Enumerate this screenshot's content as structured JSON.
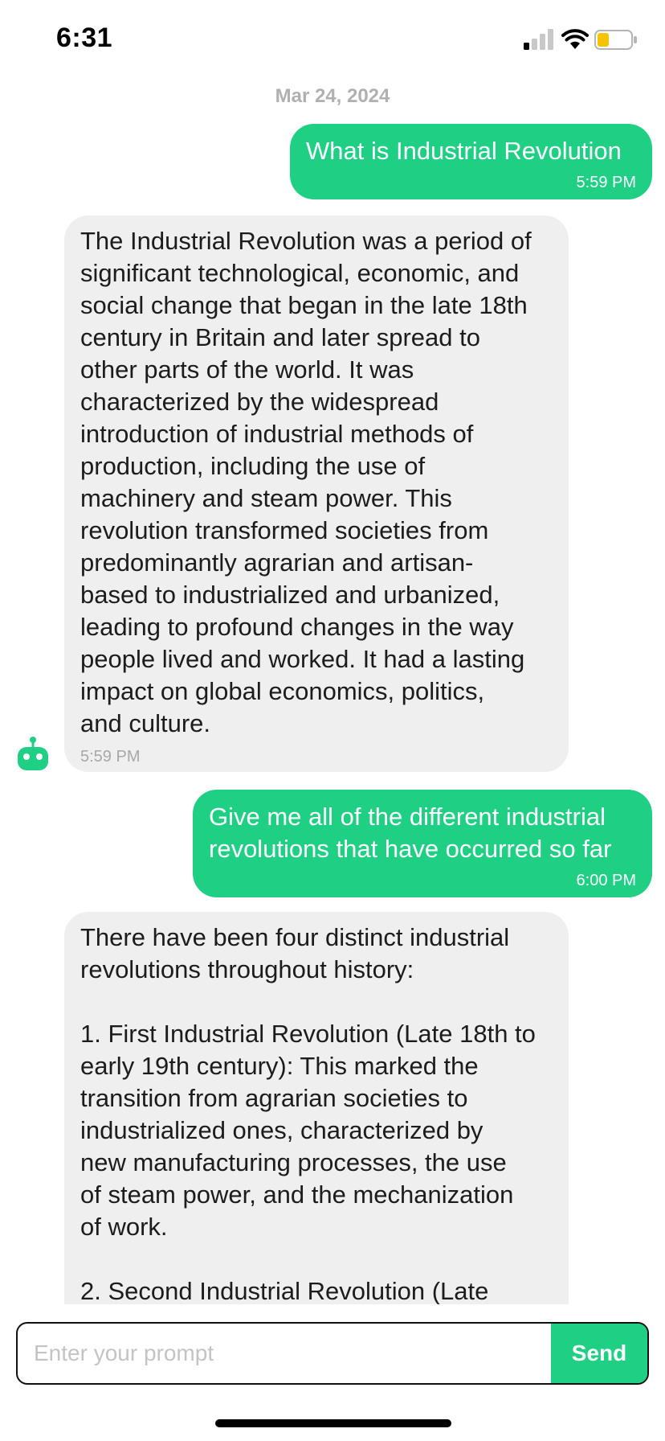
{
  "status_bar": {
    "time": "6:31",
    "signal": "signal-bars-icon",
    "wifi": "wifi-icon",
    "battery": "battery-low-icon",
    "battery_color": "#f5c400"
  },
  "chat": {
    "date": "Mar 24, 2024",
    "messages": [
      {
        "role": "user",
        "text": "What is Industrial Revolution",
        "time": "5:59 PM"
      },
      {
        "role": "bot",
        "text": "The Industrial Revolution was a period of\nsignificant technological, economic, and\nsocial change that began in the late 18th\ncentury in Britain and later spread to\nother parts of the world. It was\ncharacterized by the widespread\nintroduction of industrial methods of\nproduction, including the use of\nmachinery and steam power. This\nrevolution transformed societies from\npredominantly agrarian and artisan-\nbased to industrialized and urbanized,\nleading to profound changes in the way\npeople lived and worked. It had a lasting\nimpact on global economics, politics,\nand culture.",
        "time": "5:59 PM"
      },
      {
        "role": "user",
        "text": "Give me all of the different industrial\nrevolutions that have occurred so far",
        "time": "6:00 PM"
      },
      {
        "role": "bot",
        "text": "There have been four distinct industrial\nrevolutions throughout history:\n\n1. First Industrial Revolution (Late 18th to\nearly 19th century): This marked the\ntransition from agrarian societies to\nindustrialized ones, characterized by\nnew manufacturing processes, the use\nof steam power, and the mechanization\nof work.\n\n2. Second Industrial Revolution (Late"
      }
    ]
  },
  "input": {
    "placeholder": "Enter your prompt",
    "send_label": "Send"
  },
  "colors": {
    "accent": "#1ecf84",
    "bot_bubble": "#efefef"
  }
}
